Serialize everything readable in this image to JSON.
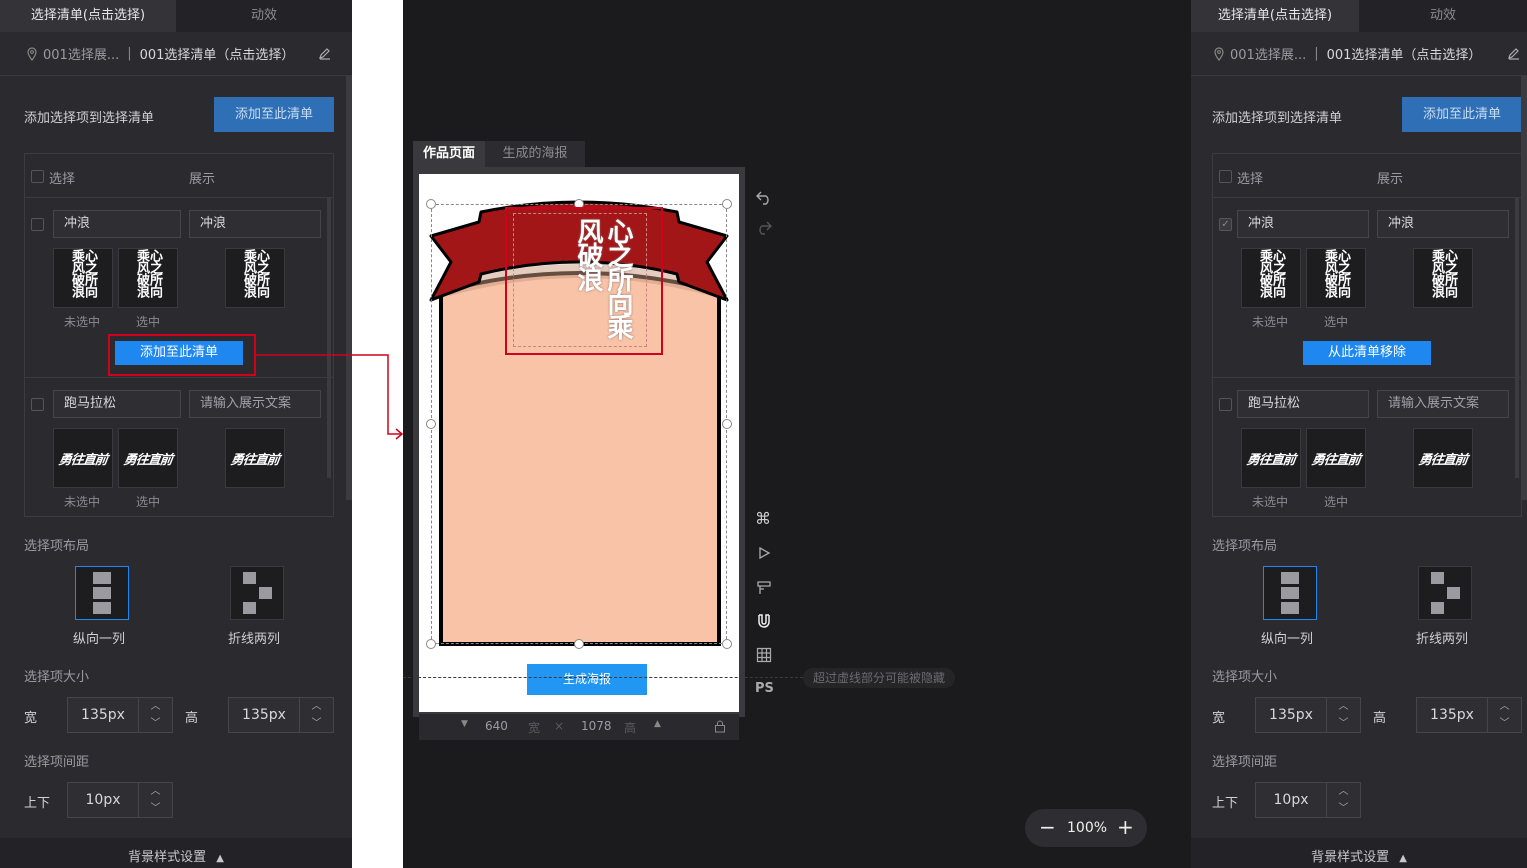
{
  "left_panel": {
    "tabs": [
      "选择清单(点击选择)",
      "动效"
    ],
    "crumb_1": "001选择展...",
    "crumb_sep": "|",
    "crumb_2": "001选择清单（点击选择）",
    "add_label": "添加选择项到选择清单",
    "add_button": "添加至此清单",
    "list_header": {
      "select": "选择",
      "display": "展示"
    },
    "items": [
      {
        "name": "冲浪",
        "display": "冲浪",
        "cap_unselected": "未选中",
        "cap_selected": "选中",
        "action": "添加至此清单",
        "checked": false
      },
      {
        "name": "跑马拉松",
        "display": "请输入展示文案",
        "cap_unselected": "未选中",
        "cap_selected": "选中"
      }
    ],
    "layout_title": "选择项布局",
    "layout_options": [
      "纵向一列",
      "折线两列"
    ],
    "size_title": "选择项大小",
    "width_label": "宽",
    "width_value": "135px",
    "height_label": "高",
    "height_value": "135px",
    "spacing_title": "选择项间距",
    "spacing_label": "上下",
    "spacing_value": "10px",
    "footer": "背景样式设置"
  },
  "right_panel": {
    "tabs": [
      "选择清单(点击选择)",
      "动效"
    ],
    "crumb_1": "001选择展...",
    "crumb_sep": "|",
    "crumb_2": "001选择清单（点击选择）",
    "add_label": "添加选择项到选择清单",
    "add_button": "添加至此清单",
    "list_header": {
      "select": "选择",
      "display": "展示"
    },
    "items": [
      {
        "name": "冲浪",
        "display": "冲浪",
        "cap_unselected": "未选中",
        "cap_selected": "选中",
        "action": "从此清单移除",
        "checked": true
      },
      {
        "name": "跑马拉松",
        "display": "请输入展示文案",
        "cap_unselected": "未选中",
        "cap_selected": "选中"
      }
    ],
    "layout_title": "选择项布局",
    "layout_options": [
      "纵向一列",
      "折线两列"
    ],
    "size_title": "选择项大小",
    "width_label": "宽",
    "width_value": "135px",
    "height_label": "高",
    "height_value": "135px",
    "spacing_title": "选择项间距",
    "spacing_label": "上下",
    "spacing_value": "10px",
    "footer": "背景样式设置"
  },
  "thumb_text": {
    "calligraphy": "心之所向乘风破浪",
    "brush": "勇往直前"
  },
  "editor": {
    "tabs": [
      "作品页面",
      "生成的海报"
    ],
    "poster_button": "生成海报",
    "hint": "超过虚线部分可能被隐藏",
    "canvas_width": "640",
    "width_unit": "宽",
    "times": "×",
    "canvas_height": "1078",
    "height_unit": "高",
    "tools_ps": "PS",
    "zoom": "100%"
  },
  "colors": {
    "accent": "#1e88f0",
    "panel_bg": "#2b2b2f",
    "canvas_bg": "#1b1b1e",
    "poster_bg": "#f8c3a6",
    "ribbon": "#a31618",
    "annot": "#d0021b"
  }
}
